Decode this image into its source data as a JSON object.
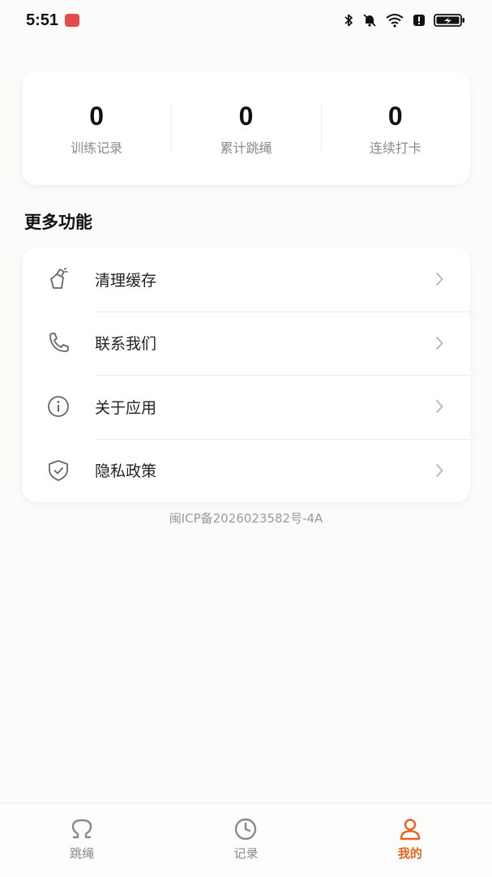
{
  "status_bar": {
    "time": "5:51"
  },
  "stats": [
    {
      "value": "0",
      "label": "训练记录"
    },
    {
      "value": "0",
      "label": "累计跳绳"
    },
    {
      "value": "0",
      "label": "连续打卡"
    }
  ],
  "more_section": {
    "title": "更多功能",
    "items": [
      {
        "label": "清理缓存",
        "icon": "clean-brush-icon"
      },
      {
        "label": "联系我们",
        "icon": "phone-icon"
      },
      {
        "label": "关于应用",
        "icon": "info-icon"
      },
      {
        "label": "隐私政策",
        "icon": "shield-check-icon"
      }
    ]
  },
  "icp": "闽ICP备2026023582号-4A",
  "bottom_nav": {
    "items": [
      {
        "label": "跳绳",
        "icon": "jump-rope-icon",
        "active": false
      },
      {
        "label": "记录",
        "icon": "clock-icon",
        "active": false
      },
      {
        "label": "我的",
        "icon": "user-icon",
        "active": true
      }
    ]
  },
  "colors": {
    "accent": "#e4651f",
    "background": "#fcfbf9",
    "card": "#ffffff"
  }
}
